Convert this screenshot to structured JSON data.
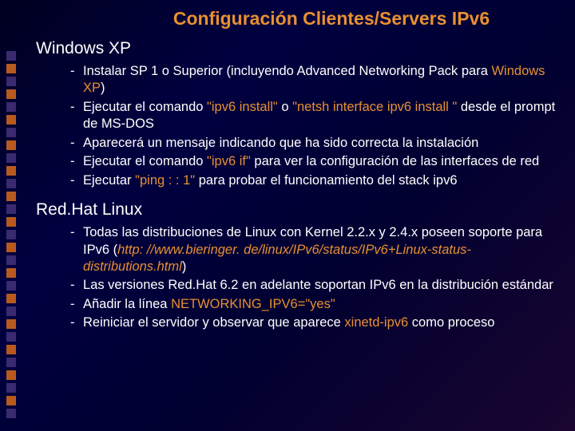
{
  "title": "Configuración Clientes/Servers IPv6",
  "sections": [
    {
      "heading": "Windows XP",
      "items": [
        {
          "pre": "Instalar SP 1 o Superior (incluyendo Advanced Networking Pack para ",
          "hl1": "Windows XP",
          "post1": ")"
        },
        {
          "pre": "Ejecutar el comando ",
          "hl1": "\"ipv6 install\"",
          "mid": " o ",
          "hl2": "\"netsh interface ipv6 install \"",
          "post1": " desde el prompt de MS-DOS"
        },
        {
          "pre": "Aparecerá un mensaje indicando que ha sido correcta la instalación"
        },
        {
          "pre": "Ejecutar el comando ",
          "hl1": "\"ipv6 if\"",
          "post1": " para ver la configuración de las interfaces de red"
        },
        {
          "pre": "Ejecutar ",
          "hl1": "\"ping : : 1\"",
          "post1": " para probar el funcionamiento del stack ipv6"
        }
      ]
    },
    {
      "heading": "Red.Hat Linux",
      "items": [
        {
          "pre": "Todas las distribuciones de Linux con Kernel 2.2.x y 2.4.x poseen soporte para IPv6 (",
          "hli": "http: //www.bieringer. de/linux/IPv6/status/IPv6+Linux-status-distributions.html",
          "post1": ")"
        },
        {
          "pre": "Las versiones Red.Hat 6.2 en adelante soportan IPv6 en la distribución estándar"
        },
        {
          "pre": "Añadir la línea ",
          "hl1": "NETWORKING_IPV6=\"yes\""
        },
        {
          "pre": "Reiniciar el servidor y observar que aparece ",
          "hl1": "xinetd-ipv6",
          "post1": " como proceso"
        }
      ]
    }
  ]
}
